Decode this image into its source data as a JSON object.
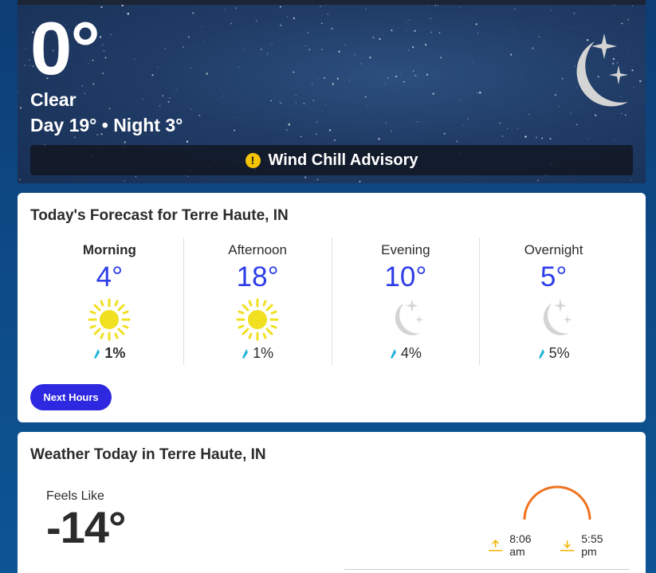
{
  "current": {
    "temperature": "0°",
    "phrase": "Clear",
    "hilo": "Day 19° • Night 3°",
    "icon": "moon-stars-icon",
    "alert_icon": "warning-icon",
    "alert_label": "Wind Chill Advisory"
  },
  "forecast": {
    "title": "Today's Forecast for Terre Haute, IN",
    "periods": [
      {
        "name": "Morning",
        "temp": "4°",
        "icon": "sun-icon",
        "precip": "1%"
      },
      {
        "name": "Afternoon",
        "temp": "18°",
        "icon": "sun-icon",
        "precip": "1%"
      },
      {
        "name": "Evening",
        "temp": "10°",
        "icon": "moon-stars-icon",
        "precip": "4%"
      },
      {
        "name": "Overnight",
        "temp": "5°",
        "icon": "moon-stars-icon",
        "precip": "5%"
      }
    ],
    "next_hours_label": "Next Hours"
  },
  "today": {
    "title": "Weather Today in Terre Haute, IN",
    "feels_like_label": "Feels Like",
    "feels_like_value": "-14°",
    "sunrise": "8:06 am",
    "sunset": "5:55 pm"
  },
  "colors": {
    "accent": "#2e28e0",
    "temp_blue": "#2d3de8",
    "sun_yellow": "#f0e020",
    "moon_gray": "#d4d4d4",
    "arc_orange": "#f07320",
    "warning_yellow": "#f5c400"
  }
}
